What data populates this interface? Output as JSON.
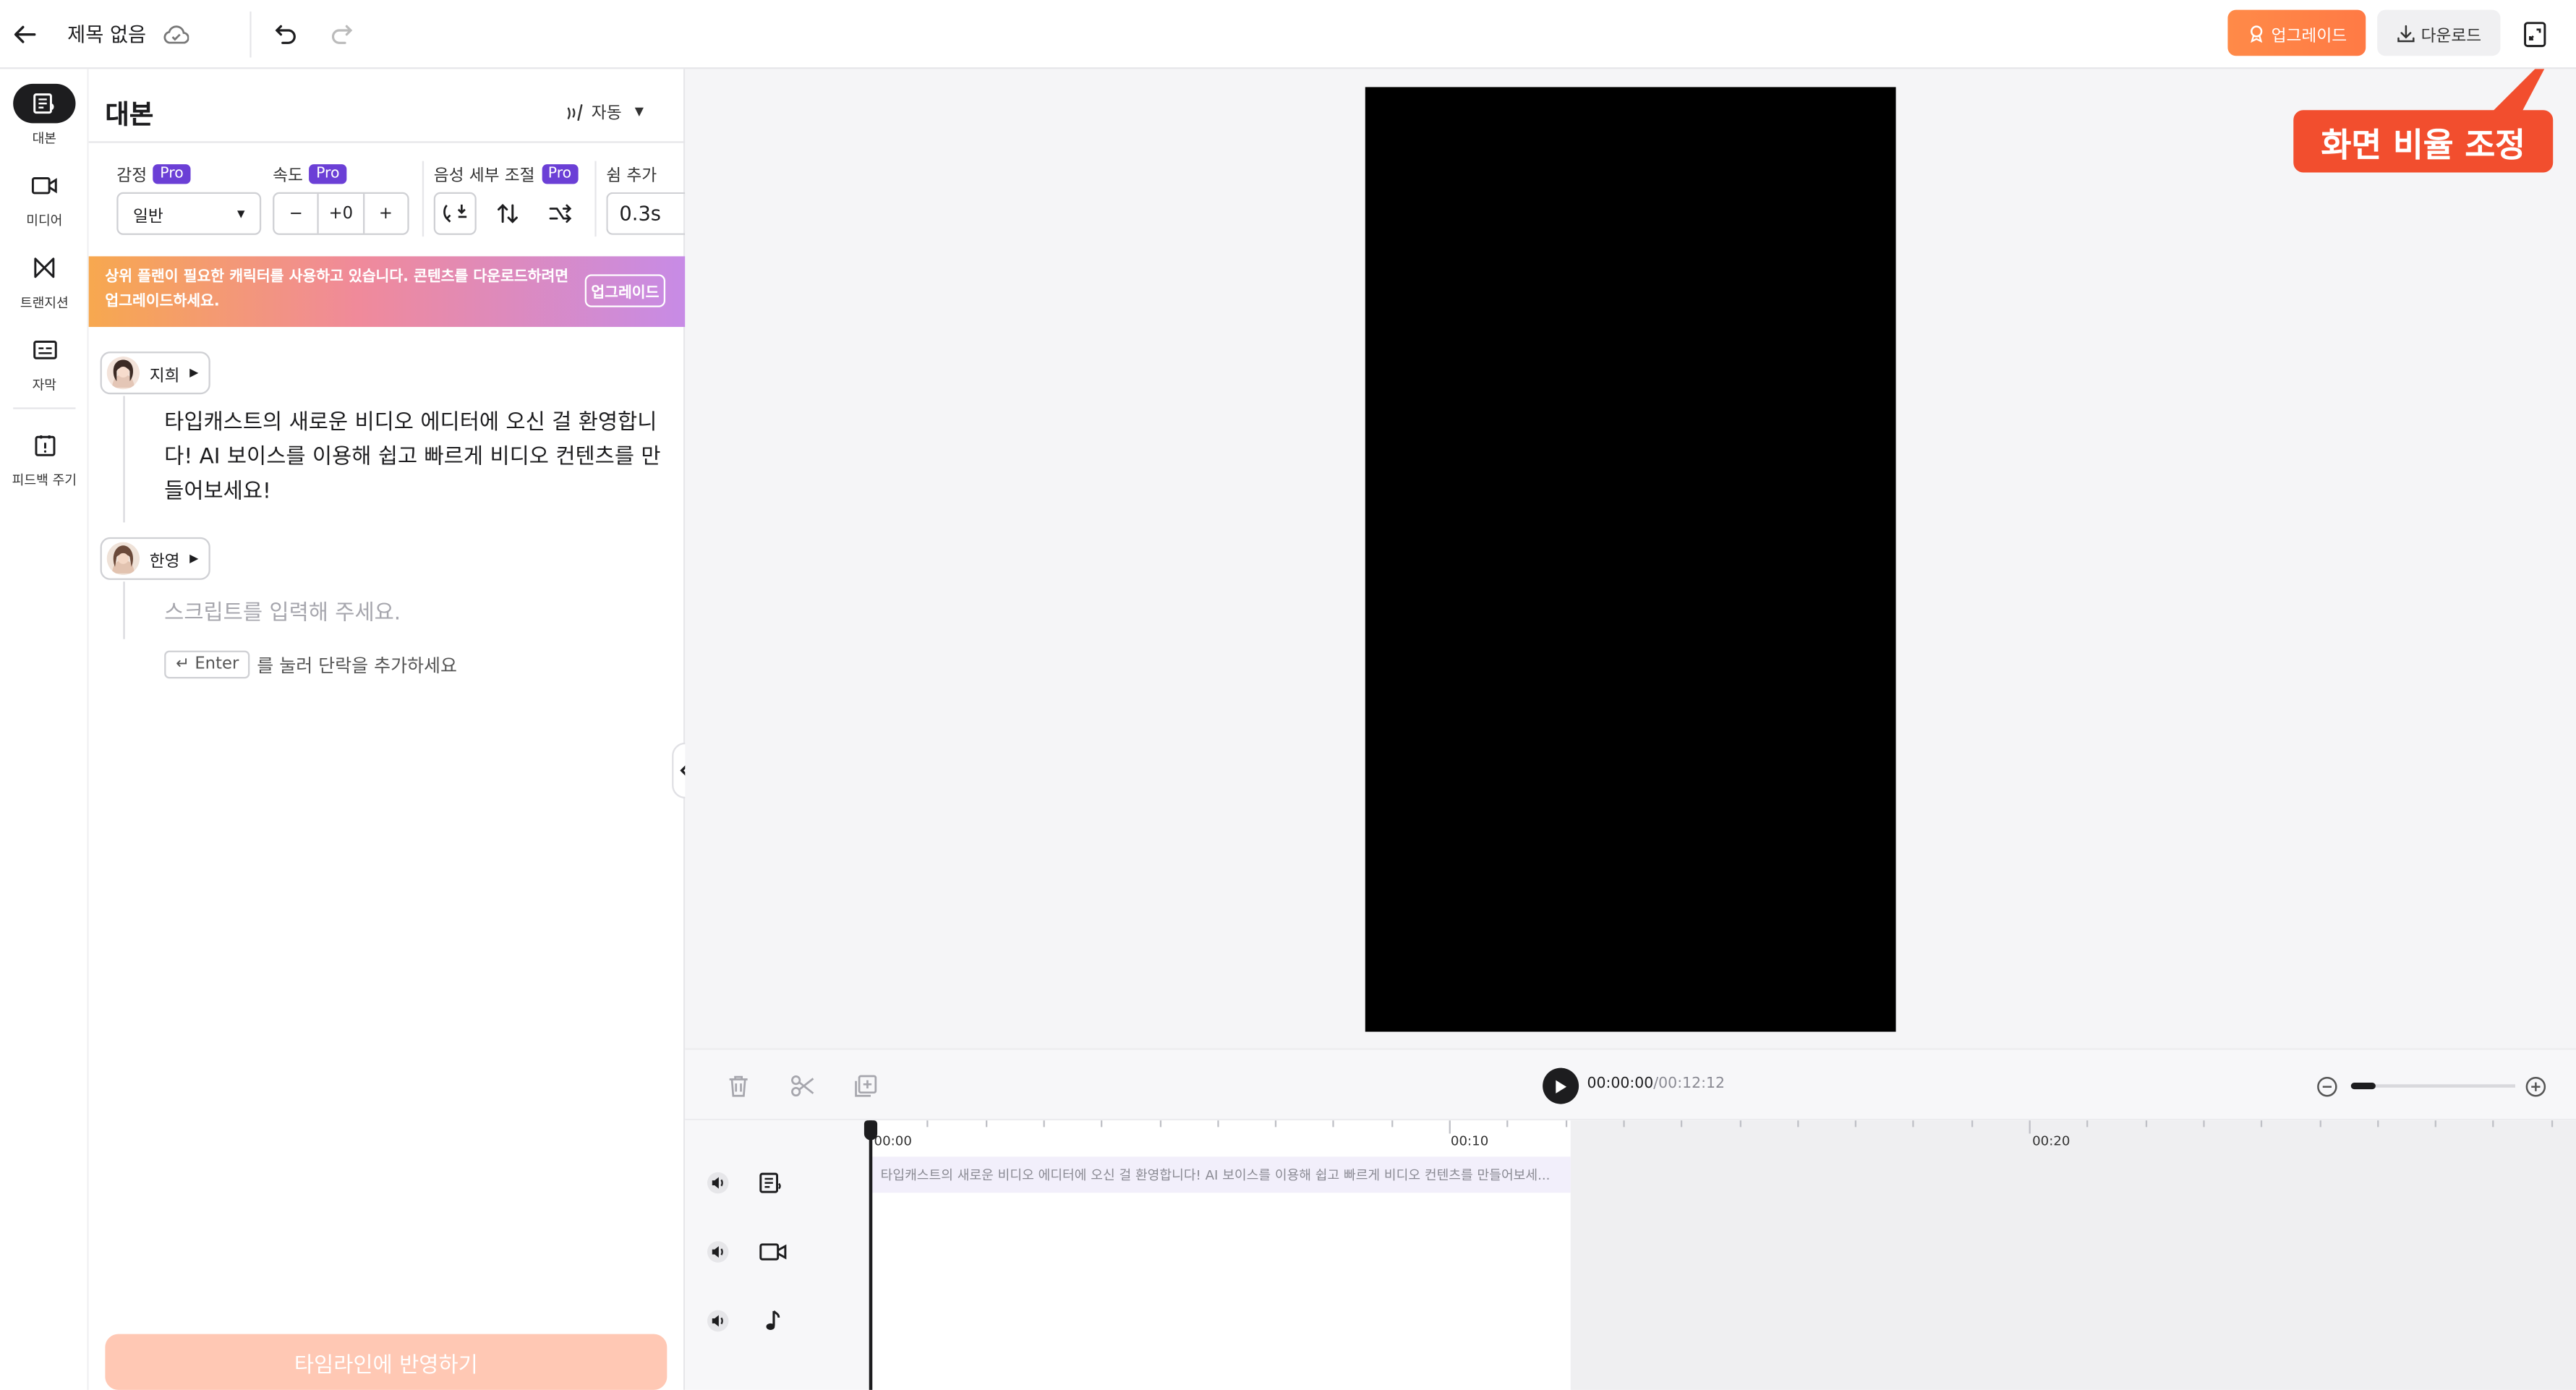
{
  "header": {
    "title": "제목 없음",
    "upgrade_label": "업그레이드",
    "download_label": "다운로드"
  },
  "rail": {
    "items": [
      {
        "label": "대본",
        "icon": "script-icon"
      },
      {
        "label": "미디어",
        "icon": "video-icon"
      },
      {
        "label": "트랜지션",
        "icon": "transition-icon"
      },
      {
        "label": "자막",
        "icon": "subtitle-icon"
      },
      {
        "label": "피드백 주기",
        "icon": "feedback-icon"
      }
    ]
  },
  "panel": {
    "title": "대본",
    "auto_label": "자동",
    "emotion_label": "감정",
    "speed_label": "속도",
    "voice_detail_label": "음성 세부 조절",
    "pause_label": "쉼 추가",
    "pro_badge": "Pro",
    "emotion_value": "일반",
    "speed_minus": "−",
    "speed_value": "+0",
    "speed_plus": "+",
    "pause_value": "0.3s",
    "banner_text": "상위 플랜이 필요한 캐릭터를 사용하고 있습니다. 콘텐츠를 다운로드하려면 업그레이드하세요.",
    "banner_button": "업그레이드",
    "blocks": [
      {
        "speaker": "지희",
        "text": "타입캐스트의 새로운 비디오 에디터에 오신 걸 환영합니다! AI 보이스를 이용해 쉽고 빠르게 비디오 컨텐츠를 만들어보세요!"
      },
      {
        "speaker": "한영",
        "placeholder": "스크립트를 입력해 주세요."
      }
    ],
    "enter_key": "↵ Enter",
    "enter_hint": "를 눌러 단락을 추가하세요",
    "apply_button": "타임라인에 반영하기"
  },
  "preview": {
    "callout": "화면 비율 조정"
  },
  "timeline": {
    "current_time": "00:00:00",
    "total_time": "/00:12:12",
    "ruler_labels": [
      "00:00",
      "00:10",
      "00:20"
    ],
    "clip_text": "타입캐스트의 새로운 비디오 에디터에 오신 걸 환영합니다! AI 보이스를 이용해 쉽고 빠르게 비디오 컨텐츠를 만들어보세...",
    "zoom_level": 0.15
  },
  "colors": {
    "accent_orange": "#ff7a45",
    "pro_purple": "#6b3fd6",
    "callout_red": "#f24e2e"
  }
}
